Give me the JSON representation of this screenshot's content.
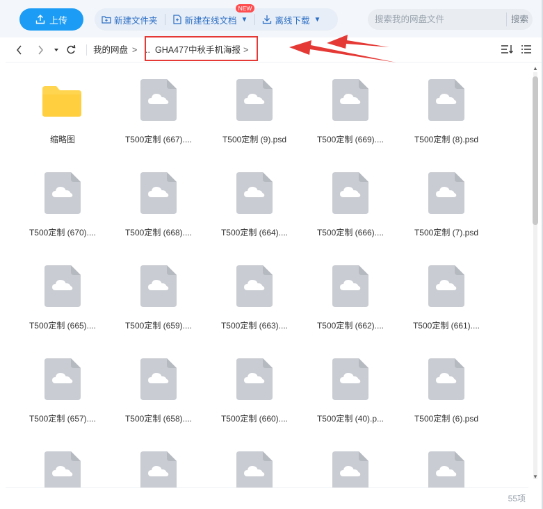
{
  "toolbar": {
    "upload_label": "上传",
    "new_folder_label": "新建文件夹",
    "new_doc_label": "新建在线文档",
    "new_badge": "NEW",
    "offline_download_label": "离线下载",
    "search_placeholder": "搜索我的网盘文件",
    "search_button": "搜索"
  },
  "nav": {
    "breadcrumb_root": "我的网盘",
    "breadcrumb_sep": ">",
    "breadcrumb_ellipsis": "..",
    "breadcrumb_current": "GHA477中秋手机海报",
    "breadcrumb_trailing": ">"
  },
  "files": [
    {
      "name": "缩略图",
      "type": "folder"
    },
    {
      "name": "T500定制 (667)....",
      "type": "file"
    },
    {
      "name": "T500定制 (9).psd",
      "type": "file"
    },
    {
      "name": "T500定制 (669)....",
      "type": "file"
    },
    {
      "name": "T500定制 (8).psd",
      "type": "file"
    },
    {
      "name": "T500定制 (670)....",
      "type": "file"
    },
    {
      "name": "T500定制 (668)....",
      "type": "file"
    },
    {
      "name": "T500定制 (664)....",
      "type": "file"
    },
    {
      "name": "T500定制 (666)....",
      "type": "file"
    },
    {
      "name": "T500定制 (7).psd",
      "type": "file"
    },
    {
      "name": "T500定制 (665)....",
      "type": "file"
    },
    {
      "name": "T500定制 (659)....",
      "type": "file"
    },
    {
      "name": "T500定制 (663)....",
      "type": "file"
    },
    {
      "name": "T500定制 (662)....",
      "type": "file"
    },
    {
      "name": "T500定制 (661)....",
      "type": "file"
    },
    {
      "name": "T500定制 (657)....",
      "type": "file"
    },
    {
      "name": "T500定制 (658)....",
      "type": "file"
    },
    {
      "name": "T500定制 (660)....",
      "type": "file"
    },
    {
      "name": "T500定制 (40).p...",
      "type": "file"
    },
    {
      "name": "T500定制 (6).psd",
      "type": "file"
    },
    {
      "name": "",
      "type": "file"
    },
    {
      "name": "",
      "type": "file"
    },
    {
      "name": "",
      "type": "file"
    },
    {
      "name": "",
      "type": "file"
    },
    {
      "name": "",
      "type": "file"
    }
  ],
  "status": {
    "count": "55项"
  },
  "colors": {
    "accent": "#1c9cf5",
    "folder": "#ffd54f",
    "file_icon": "#c9ccd2",
    "annotation": "#e53935"
  }
}
